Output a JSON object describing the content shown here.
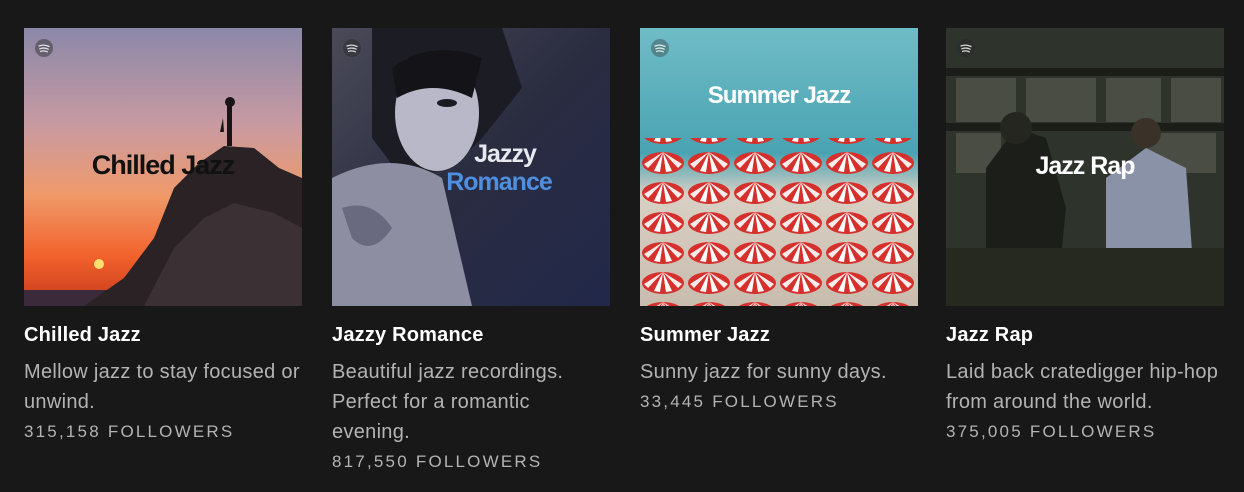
{
  "playlists": [
    {
      "cover_title_1": "Chilled Jazz",
      "name": "Chilled Jazz",
      "description": "Mellow jazz to stay focused or unwind.",
      "followers_count": "315,158",
      "followers_label": "FOLLOWERS",
      "cover_text_color": "#111111"
    },
    {
      "cover_title_1": "Jazzy",
      "cover_title_2": "Romance",
      "name": "Jazzy Romance",
      "description": "Beautiful jazz recordings. Perfect for a romantic evening.",
      "followers_count": "817,550",
      "followers_label": "FOLLOWERS",
      "cover_text_color": "#e8e8f0",
      "cover_accent_color": "#4f8fe0"
    },
    {
      "cover_title_1": "Summer Jazz",
      "name": "Summer Jazz",
      "description": "Sunny jazz for sunny days.",
      "followers_count": "33,445",
      "followers_label": "FOLLOWERS",
      "cover_text_color": "#ffffff"
    },
    {
      "cover_title_1": "Jazz Rap",
      "name": "Jazz Rap",
      "description": "Laid back cratedigger hip-hop from around the world.",
      "followers_count": "375,005",
      "followers_label": "FOLLOWERS",
      "cover_text_color": "#ffffff"
    }
  ],
  "theme": {
    "background": "#181818",
    "title_color": "#ffffff",
    "muted_color": "#b3b3b3"
  },
  "icons": {
    "cover_badge": "spotify-logo-icon"
  }
}
